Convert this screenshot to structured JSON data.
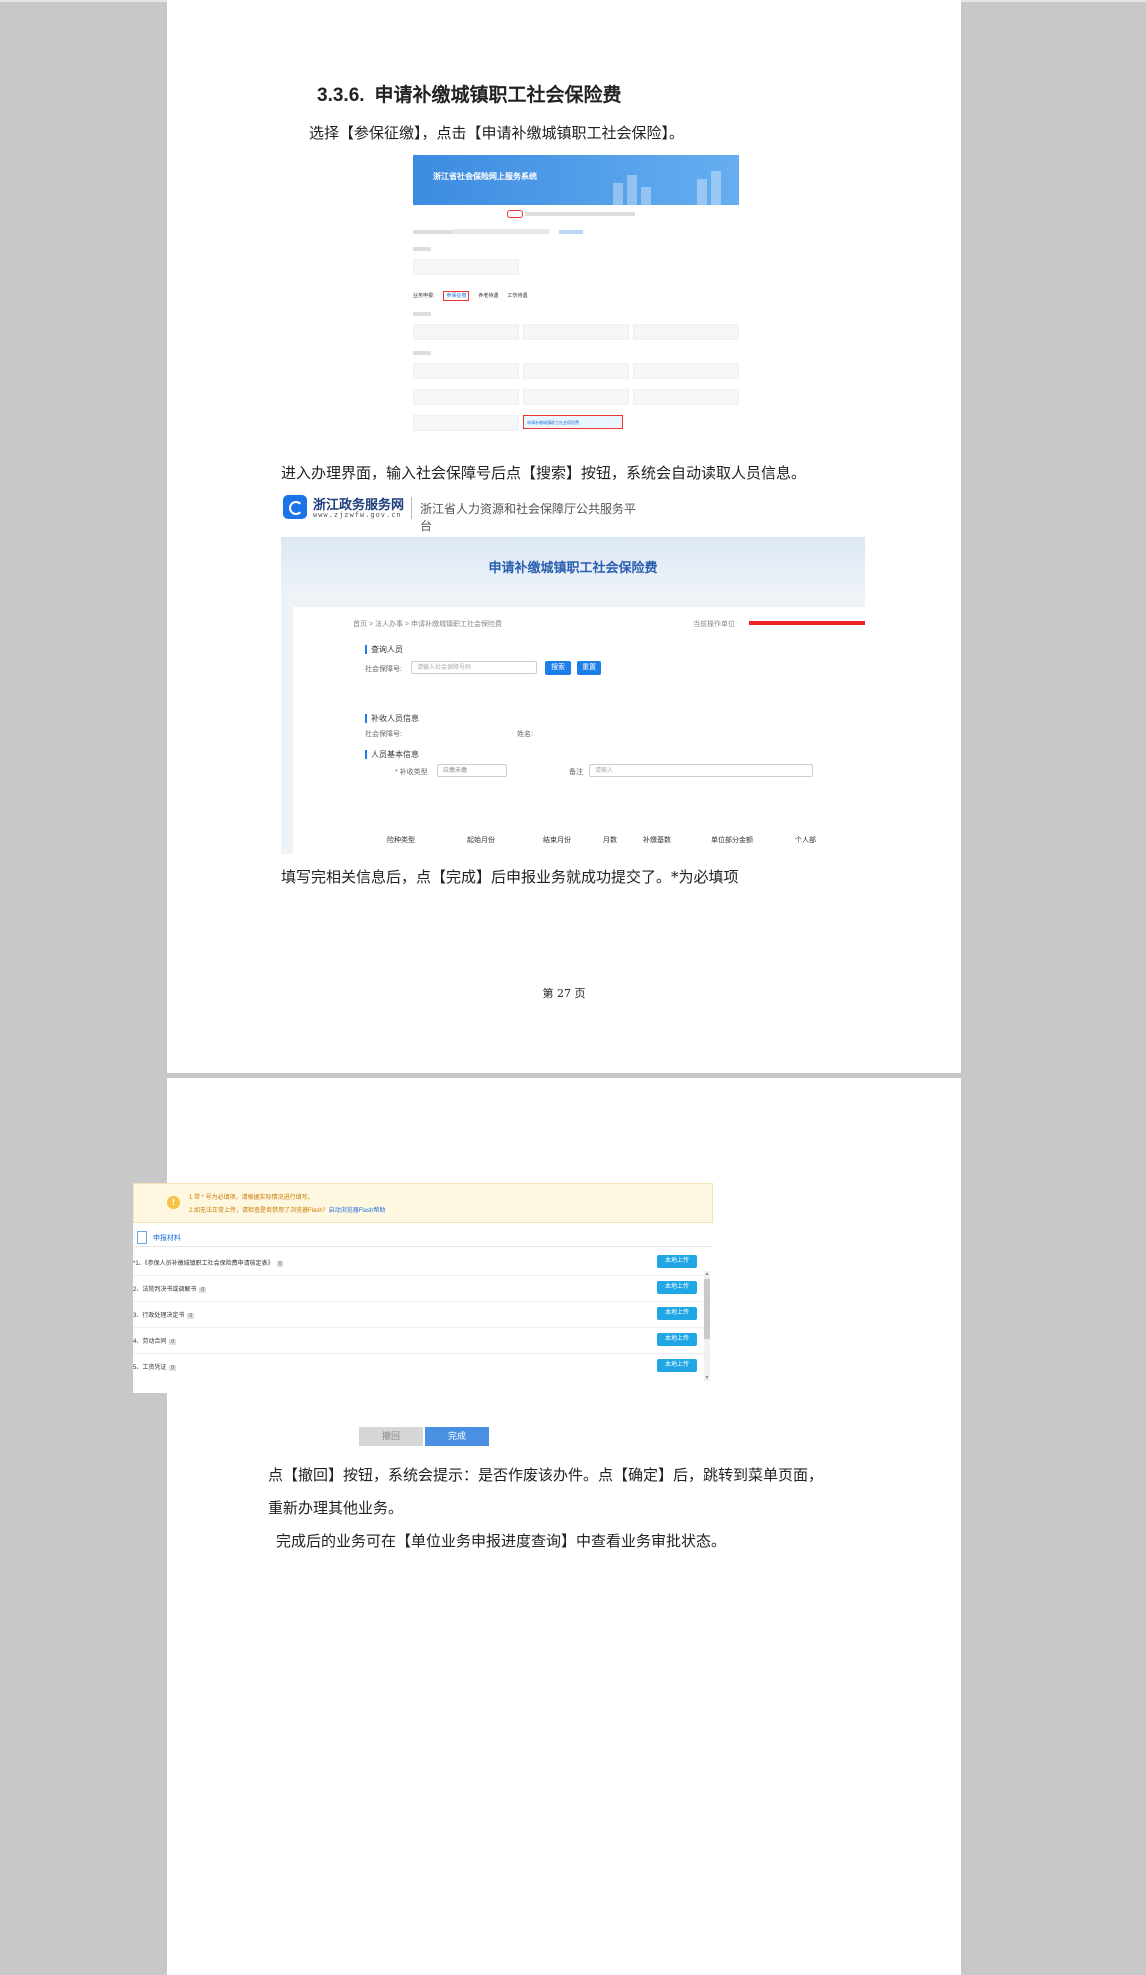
{
  "page1": {
    "heading_num": "3.3.6.",
    "heading_text": "申请补缴城镇职工社会保险费",
    "intro": "选择【参保征缴】，点击【申请补缴城镇职工社会保险】。",
    "para_enter": "进入办理界面，输入社会保障号后点【搜索】按钮，系统会自动读取人员信息。",
    "para_fill": "填写完相关信息后，点【完成】后申报业务就成功提交了。*为必填项",
    "page_number": "第 27 页"
  },
  "shot1": {
    "banner_title": "浙江省社会保险网上服务系统",
    "tabs": [
      "业务申报:",
      "参保征缴",
      "养老待遇",
      "工伤待遇"
    ],
    "highlighted_item": "申请补缴城镇职工社会保险费"
  },
  "logo": {
    "name": "浙江政务服务网",
    "url": "www.zjzwfw.gov.cn",
    "subtitle": "浙江省人力资源和社会保障厅公共服务平台"
  },
  "shot2": {
    "title": "申请补缴城镇职工社会保险费",
    "breadcrumb": "首页 > 法人办事 > 申请补缴城镇职工社会保险费",
    "operator_label": "当前操作单位",
    "section_query": "查询人员",
    "ssn_label": "社会保障号:",
    "ssn_placeholder": "请输入社会保障号码",
    "btn_search": "搜索",
    "btn_reset": "重置",
    "section_person": "补收人员信息",
    "ssn_label2": "社会保障号:",
    "name_label": "姓名:",
    "section_basic": "人员基本信息",
    "type_label": "* 补收类型",
    "type_value": "应缴未缴",
    "remark_label": "备注",
    "remark_placeholder": "请输入",
    "columns": [
      "险种类型",
      "起始月份",
      "结束月份",
      "月数",
      "补缴基数",
      "单位部分金额",
      "个人部"
    ]
  },
  "shot3": {
    "notice1": "1.带 * 号为必填项，请根据实际情况进行填写。",
    "notice2": "2.如无法正常上传，请检查是否禁用了浏览器Flash！",
    "notice2_link": "启动浏览器Flash帮助",
    "material_title": "申报材料",
    "rows": [
      {
        "label": "*1、《参保人员补缴城镇职工社会保险费申请核定表》",
        "count": "0"
      },
      {
        "label": "2、法院判决书或调解书",
        "count": "0"
      },
      {
        "label": "3、行政处理决定书",
        "count": "0"
      },
      {
        "label": "4、劳动合同",
        "count": "0"
      },
      {
        "label": "5、工资凭证",
        "count": "0"
      }
    ],
    "upload_label": "本地上传"
  },
  "buttons": {
    "undo": "撤回",
    "done": "完成"
  },
  "page2": {
    "para1": "点【撤回】按钮，系统会提示：是否作废该办件。点【确定】后，跳转到菜单页面，",
    "para2": "重新办理其他业务。",
    "para3": "完成后的业务可在【单位业务申报进度查询】中查看业务审批状态。"
  }
}
